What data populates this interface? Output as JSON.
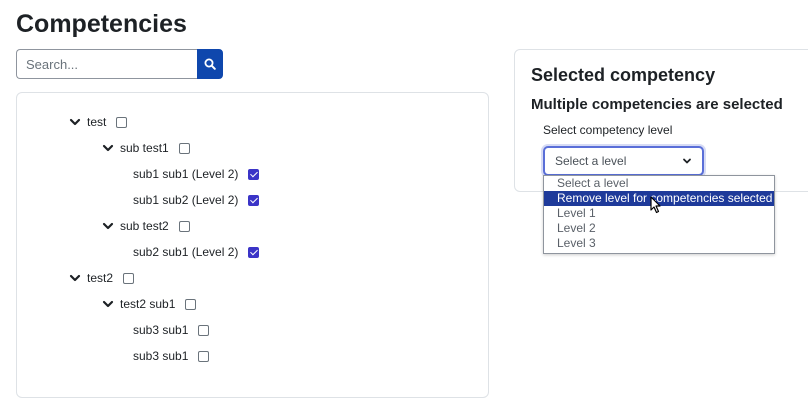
{
  "page": {
    "title": "Competencies"
  },
  "search": {
    "placeholder": "Search..."
  },
  "icons": {
    "search": "search-icon",
    "expand": "chevron-down-icon",
    "cursor": "mouse-pointer-icon"
  },
  "colors": {
    "accent": "#0f47ad",
    "checkbox_checked": "#3b34c7",
    "highlight": "#1e3a9a"
  },
  "tree": {
    "nodes": [
      {
        "label": "test",
        "expanded": true,
        "checked": false
      },
      {
        "label": "sub test1",
        "expanded": true,
        "checked": false
      },
      {
        "label": "sub1 sub1 (Level 2)",
        "checked": true
      },
      {
        "label": "sub1 sub2 (Level 2)",
        "checked": true
      },
      {
        "label": "sub test2",
        "expanded": true,
        "checked": false
      },
      {
        "label": "sub2 sub1 (Level 2)",
        "checked": true
      },
      {
        "label": "test2",
        "expanded": true,
        "checked": false
      },
      {
        "label": "test2 sub1",
        "expanded": true,
        "checked": false
      },
      {
        "label": "sub3 sub1",
        "checked": false
      },
      {
        "label": "sub3 sub1",
        "checked": false
      }
    ]
  },
  "selected": {
    "title": "Selected competency",
    "subtitle": "Multiple competencies are selected",
    "level_label": "Select competency level",
    "select_value": "Select a level",
    "options": [
      "Select a level",
      "Remove level for competencies selected",
      "Level 1",
      "Level 2",
      "Level 3"
    ],
    "highlighted_option": "Remove level for competencies selected"
  }
}
